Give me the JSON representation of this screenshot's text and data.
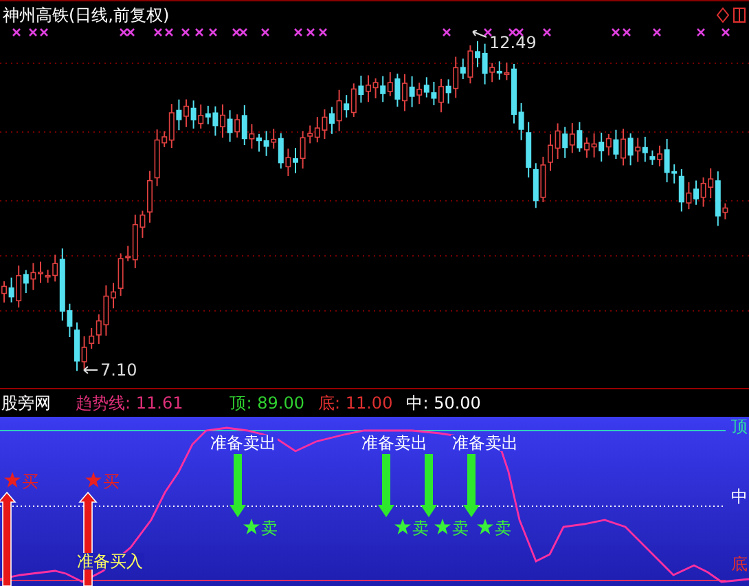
{
  "title": "神州高铁(日线,前复权)",
  "price_chart": {
    "high_label": "12.49",
    "low_label": "7.10"
  },
  "indicator": {
    "name": "股旁网",
    "readouts": [
      {
        "label": "趋势线:",
        "value": "11.61",
        "color": "#e0307a"
      },
      {
        "label": "顶:",
        "value": "89.00",
        "color": "#30d030"
      },
      {
        "label": "底:",
        "value": "11.00",
        "color": "#e03030"
      },
      {
        "label": "中:",
        "value": "50.00",
        "color": "#ffffff"
      }
    ],
    "level_labels": [
      {
        "kind": "top",
        "text": "顶"
      },
      {
        "kind": "mid",
        "text": "中"
      },
      {
        "kind": "bottom",
        "text": "底"
      }
    ],
    "signals": [
      {
        "kind": "ready_sell",
        "text": "准备卖出"
      },
      {
        "kind": "ready_sell",
        "text": "准备卖出"
      },
      {
        "kind": "ready_sell",
        "text": "准备卖出"
      },
      {
        "kind": "sell",
        "text": "卖"
      },
      {
        "kind": "sell",
        "text": "卖"
      },
      {
        "kind": "sell",
        "text": "卖"
      },
      {
        "kind": "sell",
        "text": "卖"
      },
      {
        "kind": "buy",
        "text": "买"
      },
      {
        "kind": "buy",
        "text": "买"
      },
      {
        "kind": "ready_buy",
        "text": "准备买入"
      }
    ]
  }
}
